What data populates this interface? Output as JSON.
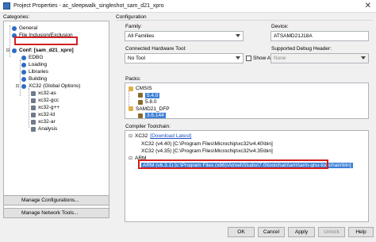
{
  "window": {
    "title": "Project Properties - ac_sleepwalk_singleshot_sam_d21_xpro",
    "close_glyph": "✕"
  },
  "left": {
    "categories_label": "Categories:",
    "tree": [
      {
        "label": "General",
        "indent": 1
      },
      {
        "label": "File Inclusion/Exclusion",
        "indent": 1
      },
      {
        "label": "Conf: [sam_d21_xpro]",
        "indent": 1,
        "bold": true
      },
      {
        "label": "EDBG",
        "indent": 2
      },
      {
        "label": "Loading",
        "indent": 2
      },
      {
        "label": "Libraries",
        "indent": 2
      },
      {
        "label": "Building",
        "indent": 2
      },
      {
        "label": "XC32 (Global Options)",
        "indent": 2
      },
      {
        "label": "xc32-as",
        "indent": 3
      },
      {
        "label": "xc32-gcc",
        "indent": 3
      },
      {
        "label": "xc32-g++",
        "indent": 3
      },
      {
        "label": "xc32-ld",
        "indent": 3
      },
      {
        "label": "xc32-ar",
        "indent": 3
      },
      {
        "label": "Analysis",
        "indent": 3
      }
    ],
    "manage_configurations": "Manage Configurations...",
    "manage_network_tools": "Manage Network Tools..."
  },
  "config": {
    "heading": "Configuration",
    "family_label": "Family:",
    "family_value": "All Families",
    "device_label": "Device:",
    "device_value": "ATSAMD21J18A",
    "connected_hw_label": "Connected Hardware Tool:",
    "connected_hw_value": "No Tool",
    "show_all_label": "Show All",
    "debug_header_label": "Supported Debug Header:",
    "debug_header_value": "None",
    "packs_label": "Packs:",
    "packs": [
      {
        "label": "CMSIS",
        "level": 0,
        "type": "folder"
      },
      {
        "label": "5.4.0",
        "level": 1,
        "type": "version",
        "selected": true
      },
      {
        "label": "5.8.0",
        "level": 1,
        "type": "version"
      },
      {
        "label": "SAMD21_DFP",
        "level": 0,
        "type": "folder"
      },
      {
        "label": "3.6.144",
        "level": 1,
        "type": "version",
        "selected": true
      }
    ],
    "compiler_label": "Compiler Toolchain:",
    "toolchain": {
      "xc32_header": "XC32",
      "download_link": "[Download Latest]",
      "xc32_entries": [
        "XC32 (v4.40) [C:\\Program Files\\Microchip\\xc32\\v4.40\\bin]",
        "XC32 (v4.35) [C:\\Program Files\\Microchip\\xc32\\v4.35\\bin]"
      ],
      "arm_header": "ARM",
      "arm_entry": "ARM (v6.3.1) [c:\\Program Files (x86)\\Atmel\\Studio\\7.0\\toolchain\\arm\\arm-gnu-toolchain\\bin]"
    }
  },
  "footer": {
    "ok": "OK",
    "cancel": "Cancel",
    "apply": "Apply",
    "unlock": "Unlock",
    "help": "Help"
  },
  "colors": {
    "highlight_red": "#d21f1f",
    "selection_blue": "#3c7fd6",
    "link_blue": "#1a4fc8"
  }
}
